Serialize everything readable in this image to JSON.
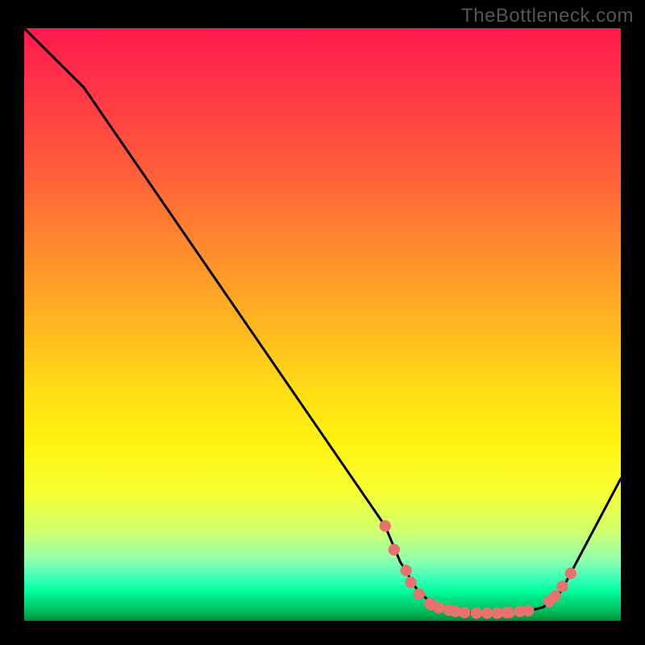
{
  "watermark": "TheBottleneck.com",
  "chart_data": {
    "type": "line",
    "title": "",
    "xlabel": "",
    "ylabel": "",
    "xlim": [
      0,
      100
    ],
    "ylim": [
      0,
      100
    ],
    "grid": false,
    "curve": [
      {
        "x": 0,
        "y": 100
      },
      {
        "x": 8,
        "y": 92
      },
      {
        "x": 10,
        "y": 90
      },
      {
        "x": 60.5,
        "y": 16
      },
      {
        "x": 63,
        "y": 10
      },
      {
        "x": 66,
        "y": 5
      },
      {
        "x": 69,
        "y": 2.4
      },
      {
        "x": 72,
        "y": 1.5
      },
      {
        "x": 78,
        "y": 1.2
      },
      {
        "x": 84,
        "y": 1.5
      },
      {
        "x": 87,
        "y": 2.3
      },
      {
        "x": 90,
        "y": 5
      },
      {
        "x": 100,
        "y": 24
      }
    ],
    "markers": [
      {
        "x": 60.5,
        "y": 16.0
      },
      {
        "x": 62.0,
        "y": 12.0
      },
      {
        "x": 64.0,
        "y": 8.5
      },
      {
        "x": 64.8,
        "y": 6.5
      },
      {
        "x": 66.2,
        "y": 4.5
      },
      {
        "x": 68.0,
        "y": 2.9
      },
      {
        "x": 68.3,
        "y": 2.7
      },
      {
        "x": 69.5,
        "y": 2.2
      },
      {
        "x": 71.2,
        "y": 1.8
      },
      {
        "x": 72.3,
        "y": 1.6
      },
      {
        "x": 73.8,
        "y": 1.4
      },
      {
        "x": 75.8,
        "y": 1.3
      },
      {
        "x": 77.6,
        "y": 1.3
      },
      {
        "x": 79.3,
        "y": 1.3
      },
      {
        "x": 80.8,
        "y": 1.4
      },
      {
        "x": 81.3,
        "y": 1.4
      },
      {
        "x": 83.1,
        "y": 1.6
      },
      {
        "x": 84.5,
        "y": 1.7
      },
      {
        "x": 88.0,
        "y": 3.3
      },
      {
        "x": 89.0,
        "y": 4.2
      },
      {
        "x": 90.2,
        "y": 5.8
      },
      {
        "x": 91.6,
        "y": 8.0
      }
    ],
    "marker_radius": 7,
    "colors": {
      "curve": "#000000",
      "markers": "#e6736e"
    }
  }
}
